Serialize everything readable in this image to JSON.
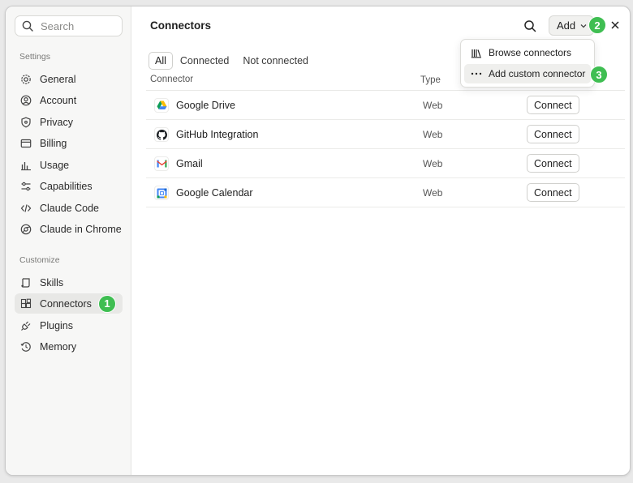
{
  "sidebar": {
    "search_placeholder": "Search",
    "sections": {
      "settings_label": "Settings",
      "customize_label": "Customize"
    },
    "settings_items": [
      {
        "label": "General",
        "icon": "gear-icon"
      },
      {
        "label": "Account",
        "icon": "user-icon"
      },
      {
        "label": "Privacy",
        "icon": "shield-icon"
      },
      {
        "label": "Billing",
        "icon": "credit-card-icon"
      },
      {
        "label": "Usage",
        "icon": "bar-chart-icon"
      },
      {
        "label": "Capabilities",
        "icon": "sliders-icon"
      },
      {
        "label": "Claude Code",
        "icon": "code-icon"
      },
      {
        "label": "Claude in Chrome",
        "icon": "globe-icon"
      }
    ],
    "customize_items": [
      {
        "label": "Skills",
        "icon": "scroll-icon"
      },
      {
        "label": "Connectors",
        "icon": "connectors-icon",
        "active": true
      },
      {
        "label": "Plugins",
        "icon": "plug-icon"
      },
      {
        "label": "Memory",
        "icon": "memory-icon"
      }
    ]
  },
  "header": {
    "title": "Connectors",
    "add_label": "Add"
  },
  "tabs": [
    {
      "label": "All",
      "active": true
    },
    {
      "label": "Connected"
    },
    {
      "label": "Not connected"
    }
  ],
  "table": {
    "columns": {
      "connector": "Connector",
      "type": "Type"
    },
    "rows": [
      {
        "name": "Google Drive",
        "type": "Web",
        "action": "Connect",
        "icon": "google-drive-icon"
      },
      {
        "name": "GitHub Integration",
        "type": "Web",
        "action": "Connect",
        "icon": "github-icon"
      },
      {
        "name": "Gmail",
        "type": "Web",
        "action": "Connect",
        "icon": "gmail-icon"
      },
      {
        "name": "Google Calendar",
        "type": "Web",
        "action": "Connect",
        "icon": "google-calendar-icon"
      }
    ]
  },
  "dropdown": {
    "items": [
      {
        "label": "Browse connectors",
        "icon": "library-icon"
      },
      {
        "label": "Add custom connector",
        "icon": "more-horizontal-icon",
        "hovered": true
      }
    ]
  },
  "step_badges": [
    "1",
    "2",
    "3"
  ],
  "colors": {
    "badge_green": "#3fbe52",
    "sidebar_bg": "#f7f7f6",
    "active_item_bg": "#e8e8e6"
  }
}
